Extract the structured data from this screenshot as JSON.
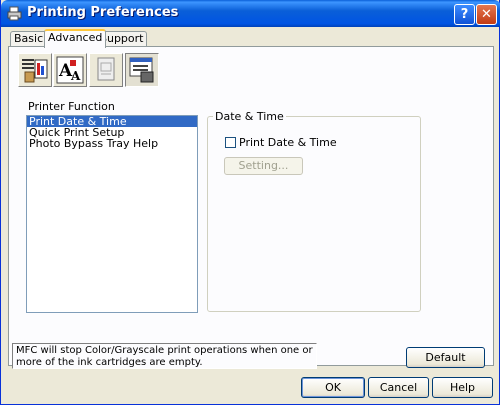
{
  "window": {
    "title": "Printing Preferences",
    "help_glyph": "?",
    "close_glyph": "✕"
  },
  "tabs": [
    {
      "label": "Basic"
    },
    {
      "label": "Advanced",
      "selected": true
    },
    {
      "label": "Support"
    }
  ],
  "toolbar": {
    "buttons": [
      {
        "icon": "print-quality-icon",
        "pressed": false
      },
      {
        "icon": "font-icon",
        "pressed": false
      },
      {
        "icon": "watermark-icon",
        "pressed": false
      },
      {
        "icon": "device-options-icon",
        "pressed": true
      }
    ]
  },
  "printer_function": {
    "label": "Printer Function",
    "items": [
      {
        "label": "Print Date & Time",
        "selected": true
      },
      {
        "label": "Quick Print Setup"
      },
      {
        "label": "Photo Bypass Tray Help"
      }
    ]
  },
  "date_time": {
    "group_title": "Date & Time",
    "checkbox_label": "Print Date & Time",
    "checked": false,
    "setting_button": "Setting..."
  },
  "status_message": "MFC will stop Color/Grayscale print operations when one or more of the ink cartridges are empty.",
  "buttons": {
    "default": "Default",
    "ok": "OK",
    "cancel": "Cancel",
    "help": "Help"
  },
  "colors": {
    "titlebar": "#0054e3",
    "selection": "#316ac5",
    "tab_highlight": "#ffc83c"
  }
}
